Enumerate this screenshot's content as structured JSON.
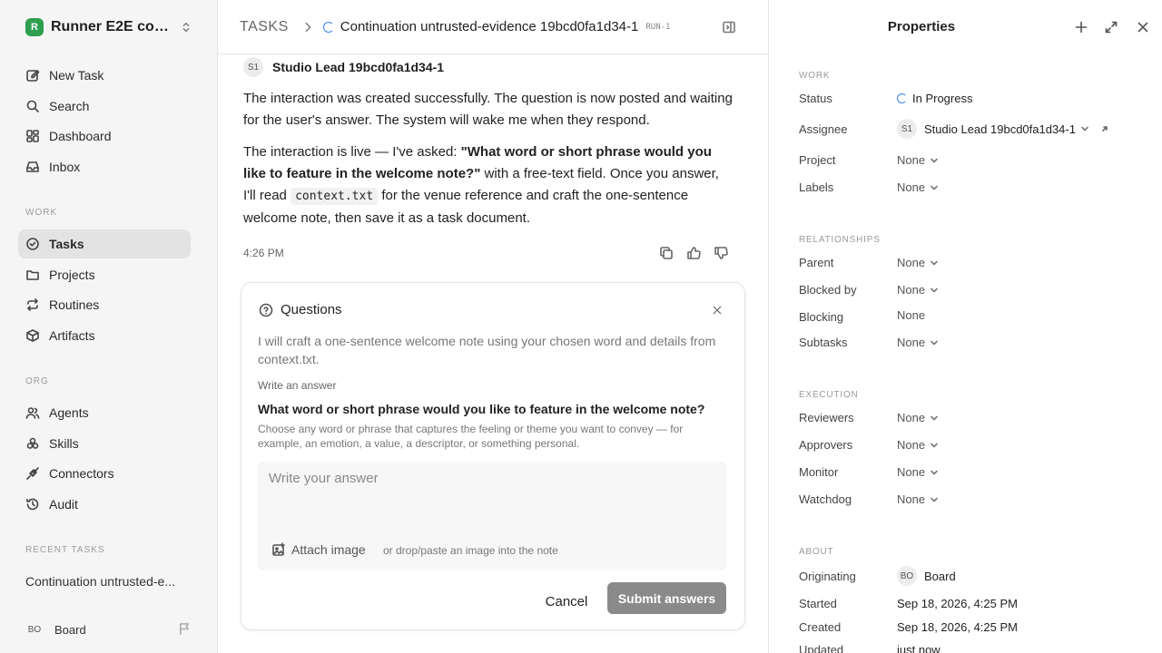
{
  "sidebar": {
    "workspace": {
      "logo": "R",
      "name": "Runner E2E conti..."
    },
    "top_nav": [
      {
        "label": "New Task",
        "icon": "edit-icon"
      },
      {
        "label": "Search",
        "icon": "search-icon"
      },
      {
        "label": "Dashboard",
        "icon": "dashboard-icon"
      },
      {
        "label": "Inbox",
        "icon": "inbox-icon"
      }
    ],
    "work_section": "WORK",
    "work_nav": [
      {
        "label": "Tasks",
        "icon": "check-circle-icon",
        "active": true
      },
      {
        "label": "Projects",
        "icon": "folder-icon"
      },
      {
        "label": "Routines",
        "icon": "repeat-icon"
      },
      {
        "label": "Artifacts",
        "icon": "box-icon"
      }
    ],
    "org_section": "ORG",
    "org_nav": [
      {
        "label": "Agents",
        "icon": "users-icon"
      },
      {
        "label": "Skills",
        "icon": "skills-icon"
      },
      {
        "label": "Connectors",
        "icon": "plug-icon"
      },
      {
        "label": "Audit",
        "icon": "history-icon"
      }
    ],
    "recent_section": "RECENT TASKS",
    "recent_tasks": [
      "Continuation untrusted-e..."
    ],
    "footer": {
      "avatar": "BO",
      "name": "Board"
    }
  },
  "header": {
    "root": "TASKS",
    "title": "Continuation untrusted-evidence 19bcd0fa1d34-1",
    "run": "RUN-1"
  },
  "message": {
    "author_avatar": "S1",
    "author_name": "Studio Lead 19bcd0fa1d34-1",
    "para1": "The interaction was created successfully. The question is now posted and waiting for the user's answer. The system will wake me when they respond.",
    "para2_a": "The interaction is live — I've asked: ",
    "para2_b": "\"What word or short phrase would you like to feature in the welcome note?\"",
    "para2_c": " with a free-text field. Once you answer, I'll read ",
    "para2_code": "context.txt",
    "para2_d": " for the venue reference and craft the one-sentence welcome note, then save it as a task document.",
    "time": "4:26 PM"
  },
  "questions": {
    "title": "Questions",
    "intro": "I will craft a one-sentence welcome note using your chosen word and details from context.txt.",
    "kind": "Write an answer",
    "question": "What word or short phrase would you like to feature in the welcome note?",
    "help": "Choose any word or phrase that captures the feeling or theme you want to convey — for example, an emotion, a value, a descriptor, or something personal.",
    "answer_placeholder": "Write your answer",
    "answer_value": "",
    "attach_label": "Attach image",
    "drop_hint": "or drop/paste an image into the note",
    "cancel_label": "Cancel",
    "submit_label": "Submit answers"
  },
  "properties": {
    "title": "Properties",
    "work_section": "WORK",
    "status_label": "Status",
    "status_value": "In Progress",
    "assignee_label": "Assignee",
    "assignee_avatar": "S1",
    "assignee_value": "Studio Lead 19bcd0fa1d34-1",
    "project_label": "Project",
    "project_value": "None",
    "labels_label": "Labels",
    "labels_value": "None",
    "rel_section": "RELATIONSHIPS",
    "parent_label": "Parent",
    "parent_value": "None",
    "blockedby_label": "Blocked by",
    "blockedby_value": "None",
    "blocking_label": "Blocking",
    "blocking_value": "None",
    "subtasks_label": "Subtasks",
    "subtasks_value": "None",
    "exec_section": "EXECUTION",
    "reviewers_label": "Reviewers",
    "reviewers_value": "None",
    "approvers_label": "Approvers",
    "approvers_value": "None",
    "monitor_label": "Monitor",
    "monitor_value": "None",
    "watchdog_label": "Watchdog",
    "watchdog_value": "None",
    "about_section": "ABOUT",
    "originating_label": "Originating",
    "originating_avatar": "BO",
    "originating_value": "Board",
    "started_label": "Started",
    "started_value": "Sep 18, 2026, 4:25 PM",
    "created_label": "Created",
    "created_value": "Sep 18, 2026, 4:25 PM",
    "updated_label": "Updated",
    "updated_value": "just now"
  },
  "colors": {
    "accent_blue": "#3b82f6",
    "brand_green": "#2e9e4f",
    "submit_gray": "#8a8a8a"
  }
}
